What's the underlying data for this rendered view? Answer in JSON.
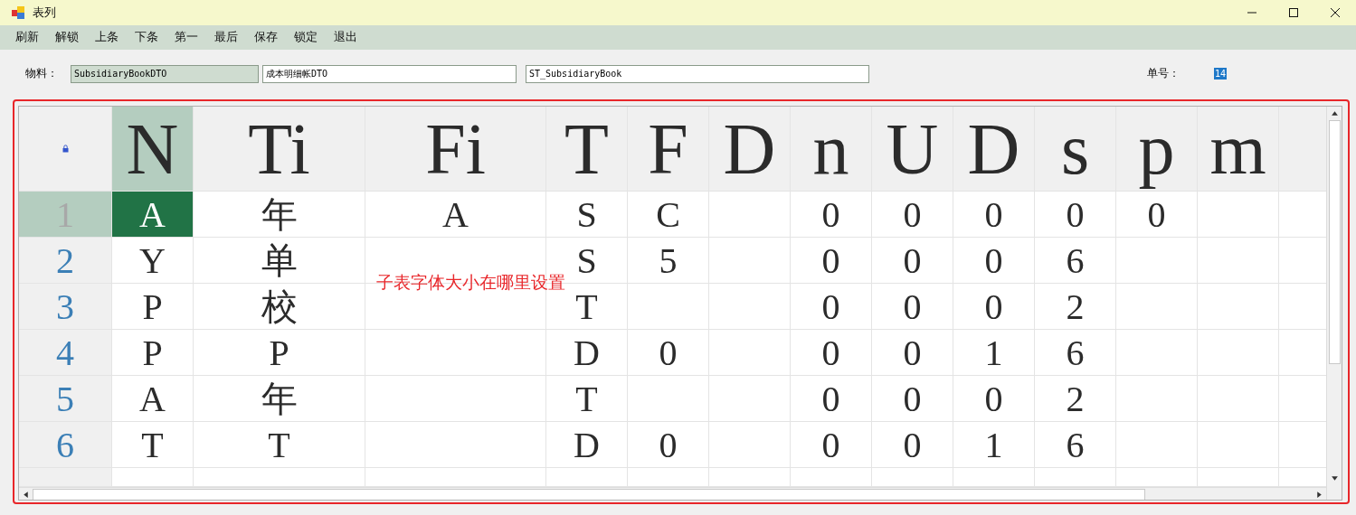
{
  "window": {
    "title": "表列"
  },
  "menu": [
    "刷新",
    "解锁",
    "上条",
    "下条",
    "第一",
    "最后",
    "保存",
    "锁定",
    "退出"
  ],
  "form": {
    "material_label": "物料：",
    "fields": [
      {
        "value": "SubsidiaryBookDTO",
        "readonly": true
      },
      {
        "value": "成本明细帐DTO",
        "readonly": false
      },
      {
        "value": "ST_SubsidiaryBook",
        "readonly": false
      }
    ],
    "number_label": "单号：",
    "number_value": "14"
  },
  "grid": {
    "columns": [
      {
        "header": "N",
        "selected": true
      },
      {
        "header": "Ti",
        "selected": false
      },
      {
        "header": "Fi",
        "selected": false
      },
      {
        "header": "T",
        "selected": false
      },
      {
        "header": "F",
        "selected": false
      },
      {
        "header": "D",
        "selected": false
      },
      {
        "header": "n",
        "selected": false
      },
      {
        "header": "U",
        "selected": false
      },
      {
        "header": "D",
        "selected": false
      },
      {
        "header": "s",
        "selected": false
      },
      {
        "header": "p",
        "selected": false
      },
      {
        "header": "m",
        "selected": false
      }
    ],
    "rows": [
      {
        "number": "1",
        "selected": true,
        "cells": [
          "A",
          "年",
          "A",
          "S",
          "C",
          null,
          "0",
          "0",
          "0",
          "0",
          "0",
          null
        ]
      },
      {
        "number": "2",
        "selected": false,
        "cells": [
          "Y",
          "单",
          null,
          "S",
          "5",
          null,
          "0",
          "0",
          "0",
          "6",
          null,
          null
        ]
      },
      {
        "number": "3",
        "selected": false,
        "cells": [
          "P",
          "校",
          null,
          "T",
          null,
          null,
          "0",
          "0",
          "0",
          "2",
          null,
          null
        ]
      },
      {
        "number": "4",
        "selected": false,
        "cells": [
          "P",
          "P",
          null,
          "D",
          "0",
          null,
          "0",
          "0",
          "1",
          "6",
          null,
          null
        ]
      },
      {
        "number": "5",
        "selected": false,
        "cells": [
          "A",
          "年",
          null,
          "T",
          null,
          null,
          "0",
          "0",
          "0",
          "2",
          null,
          null
        ]
      },
      {
        "number": "6",
        "selected": false,
        "cells": [
          "T",
          "T",
          null,
          "D",
          "0",
          null,
          "0",
          "0",
          "1",
          "6",
          null,
          null
        ]
      }
    ]
  },
  "annotation": {
    "text": "子表字体大小在哪里设置"
  }
}
